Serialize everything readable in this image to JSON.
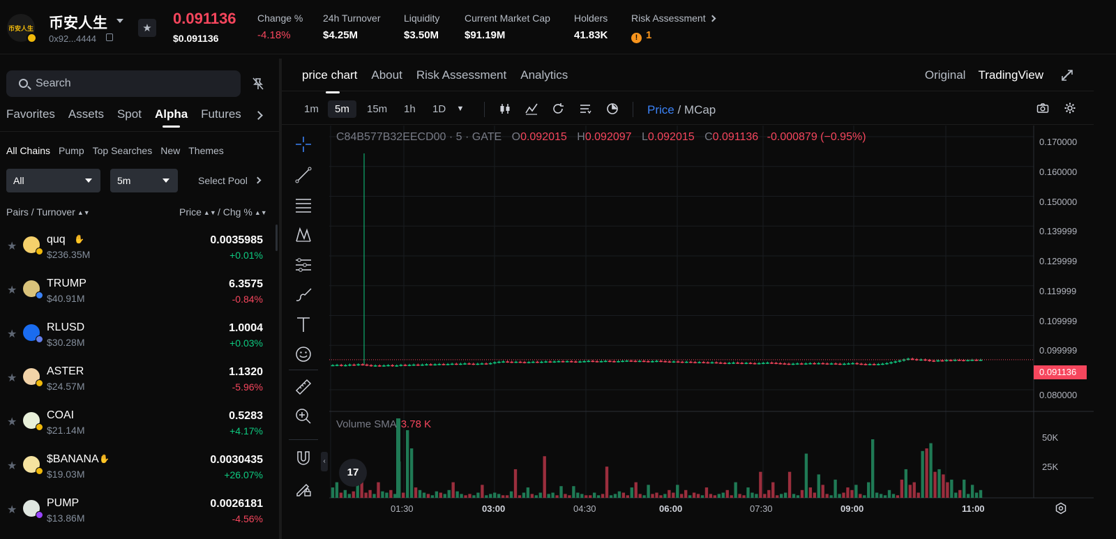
{
  "header": {
    "token_name": "币安人生",
    "token_logo_text": "币安人生",
    "address": "0x92...4444",
    "price": "0.091136",
    "price_usd": "$0.091136",
    "stats": [
      {
        "label": "Change %",
        "value": "-4.18%",
        "color": "red"
      },
      {
        "label": "24h Turnover",
        "value": "$4.25M"
      },
      {
        "label": "Liquidity",
        "value": "$3.50M"
      },
      {
        "label": "Current Market Cap",
        "value": "$91.19M"
      },
      {
        "label": "Holders",
        "value": "41.83K"
      }
    ],
    "risk": {
      "label": "Risk Assessment",
      "count": "1"
    }
  },
  "sidebar": {
    "search_placeholder": "Search",
    "tabs": [
      "Favorites",
      "Assets",
      "Spot",
      "Alpha",
      "Futures"
    ],
    "active_tab": "Alpha",
    "sub_tabs": [
      "All Chains",
      "Pump",
      "Top Searches",
      "New",
      "Themes"
    ],
    "filter_chain": "All",
    "filter_interval": "5m",
    "pool_select": "Select Pool",
    "col_pairs": "Pairs / Turnover",
    "col_price": "Price",
    "col_chg": "/ Chg %",
    "rows": [
      {
        "symbol": "quq",
        "turnover": "$236.35M",
        "price": "0.0035985",
        "change": "+0.01%",
        "dir": "up",
        "avatar_color": "#f5d06b",
        "badge_color": "#f0b90b",
        "tag": true
      },
      {
        "symbol": "TRUMP",
        "turnover": "$40.91M",
        "price": "6.3575",
        "change": "-0.84%",
        "dir": "dn",
        "avatar_color": "#d9c27a",
        "badge_color": "#3b82f6",
        "tag": false
      },
      {
        "symbol": "RLUSD",
        "turnover": "$30.28M",
        "price": "1.0004",
        "change": "+0.03%",
        "dir": "up",
        "avatar_color": "#1a6cf0",
        "badge_color": "#627eea",
        "tag": false
      },
      {
        "symbol": "ASTER",
        "turnover": "$24.57M",
        "price": "1.1320",
        "change": "-5.96%",
        "dir": "dn",
        "avatar_color": "#f2d3a8",
        "badge_color": "#f0b90b",
        "tag": false
      },
      {
        "symbol": "COAI",
        "turnover": "$21.14M",
        "price": "0.5283",
        "change": "+4.17%",
        "dir": "up",
        "avatar_color": "#e8f0d9",
        "badge_color": "#f0b90b",
        "tag": false
      },
      {
        "symbol": "$BANANA",
        "turnover": "$19.03M",
        "price": "0.0030435",
        "change": "+26.07%",
        "dir": "up",
        "avatar_color": "#f5e3a0",
        "badge_color": "#f0b90b",
        "tag": true
      },
      {
        "symbol": "PUMP",
        "turnover": "$13.86M",
        "price": "0.0026181",
        "change": "-4.56%",
        "dir": "dn",
        "avatar_color": "#dfe6e0",
        "badge_color": "#9945ff",
        "tag": false
      }
    ]
  },
  "chart_panel": {
    "tabs": [
      "price chart",
      "About",
      "Risk Assessment",
      "Analytics"
    ],
    "active_tab": "price chart",
    "view_original": "Original",
    "view_tradingview": "TradingView",
    "intervals": [
      "1m",
      "5m",
      "15m",
      "1h",
      "1D"
    ],
    "active_interval": "5m",
    "price_toggle": "Price",
    "mcap_toggle": "MCap",
    "legend": {
      "name": "C84B577B32EECD00 · 5 · GATE",
      "open": "0.092015",
      "high": "0.092097",
      "low": "0.092015",
      "close": "0.091136",
      "change": "-0.000879 (−0.95%)"
    },
    "volume_label": "Volume SMA",
    "volume_value": "3.78 K",
    "tv_logo": "17"
  },
  "chart_data": {
    "type": "candlestick",
    "y_ticks": [
      "0.170000",
      "0.160000",
      "0.150000",
      "0.139999",
      "0.129999",
      "0.119999",
      "0.109999",
      "0.099999",
      "0.080000"
    ],
    "ylim": [
      0.08,
      0.17
    ],
    "last_price": "0.091136",
    "volume_ticks": [
      "50K",
      "25K"
    ],
    "x_ticks": [
      "01:30",
      "03:00",
      "04:30",
      "06:00",
      "07:30",
      "09:00",
      "11:00"
    ],
    "x_ticks_bold": [
      "03:00",
      "06:00",
      "09:00",
      "11:00"
    ],
    "candles_close": [
      0.0892,
      0.0893,
      0.0891,
      0.0892,
      0.0894,
      0.0893,
      0.0895,
      0.0894,
      0.0892,
      0.089,
      0.0891,
      0.089,
      0.0891,
      0.0892,
      0.089,
      0.0891,
      0.0893,
      0.0892,
      0.0893,
      0.0894,
      0.0893,
      0.0894,
      0.0895,
      0.0894,
      0.0895,
      0.0896,
      0.0895,
      0.0896,
      0.0897,
      0.0896,
      0.0897,
      0.0898,
      0.0897,
      0.0896,
      0.0897,
      0.0898,
      0.0897,
      0.0899,
      0.0902,
      0.0904,
      0.0905,
      0.0904,
      0.0903,
      0.0904,
      0.0903,
      0.0902,
      0.0903,
      0.0904,
      0.0903,
      0.0904,
      0.0905,
      0.0904,
      0.0905,
      0.0906,
      0.0905,
      0.0906,
      0.0905,
      0.0904,
      0.0905,
      0.0906,
      0.0907,
      0.0906,
      0.0905,
      0.0906,
      0.0907,
      0.0906,
      0.0905,
      0.0906,
      0.0907,
      0.0908,
      0.0907,
      0.0906,
      0.0907,
      0.0906,
      0.0905,
      0.0906,
      0.0907,
      0.0906,
      0.0905,
      0.0904,
      0.0905,
      0.0904,
      0.0903,
      0.0904,
      0.0903,
      0.0902,
      0.0903,
      0.0902,
      0.0901,
      0.0902,
      0.0901,
      0.09,
      0.0899,
      0.09,
      0.0901,
      0.09,
      0.0899,
      0.09,
      0.0899,
      0.0898,
      0.0899,
      0.09,
      0.0901,
      0.09,
      0.0899,
      0.0898,
      0.0897,
      0.0896,
      0.0897,
      0.0898,
      0.0897,
      0.0898,
      0.0899,
      0.0898,
      0.0899,
      0.0898,
      0.0897,
      0.0898,
      0.0897,
      0.0896,
      0.0897,
      0.0898,
      0.0899,
      0.0897,
      0.0896,
      0.0895,
      0.0896,
      0.0895,
      0.0896,
      0.0897,
      0.0899,
      0.0902,
      0.0905,
      0.0908,
      0.0912,
      0.0915,
      0.0913,
      0.0911,
      0.0912,
      0.091,
      0.0908,
      0.0907,
      0.0909,
      0.0908,
      0.091,
      0.0909,
      0.0911,
      0.091,
      0.0909,
      0.091,
      0.0911,
      0.091,
      0.0911
    ],
    "volumes": [
      8,
      12,
      4,
      6,
      3,
      5,
      22,
      14,
      4,
      6,
      3,
      12,
      5,
      4,
      6,
      3,
      28,
      4,
      52,
      38,
      8,
      6,
      4,
      3,
      2,
      5,
      4,
      3,
      6,
      12,
      5,
      3,
      2,
      3,
      2,
      4,
      10,
      2,
      3,
      4,
      3,
      2,
      2,
      5,
      22,
      2,
      4,
      8,
      3,
      2,
      4,
      32,
      3,
      4,
      2,
      9,
      3,
      2,
      9,
      4,
      3,
      2,
      2,
      4,
      2,
      3,
      24,
      2,
      3,
      5,
      4,
      2,
      8,
      12,
      3,
      2,
      10,
      3,
      4,
      2,
      3,
      6,
      4,
      10,
      3,
      6,
      2,
      4,
      3,
      2,
      8,
      3,
      2,
      3,
      4,
      6,
      2,
      12,
      3,
      2,
      8,
      4,
      3,
      20,
      3,
      6,
      12,
      2,
      3,
      4,
      20,
      3,
      2,
      6,
      34,
      8,
      4,
      18,
      10,
      3,
      2,
      14,
      3,
      4,
      8,
      6,
      10,
      3,
      2,
      12,
      45,
      4,
      3,
      2,
      6,
      3,
      2,
      14,
      22,
      10,
      12,
      4,
      36,
      38,
      42,
      20,
      22,
      18,
      12,
      14,
      4,
      6,
      14,
      3,
      10,
      4,
      6
    ]
  }
}
